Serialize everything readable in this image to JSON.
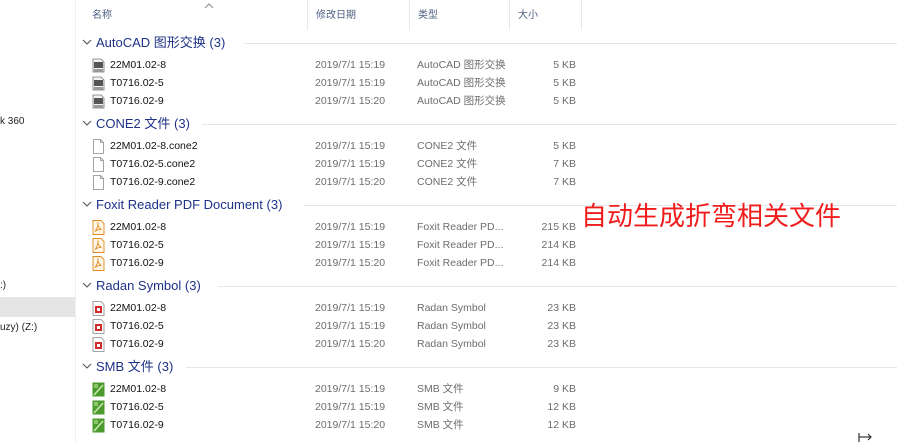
{
  "sidebar": {
    "items": [
      {
        "label": "k 360",
        "selected": false
      },
      {
        "label": ":)",
        "selected": false
      },
      {
        "label": "",
        "selected": true
      },
      {
        "label": "uzy) (Z:)",
        "selected": false
      }
    ]
  },
  "columns": {
    "name": "名称",
    "date": "修改日期",
    "type": "类型",
    "size": "大小"
  },
  "groups": [
    {
      "title": "AutoCAD 图形交换 (3)",
      "icon": "dxf-file-icon",
      "files": [
        {
          "name": "22M01.02-8",
          "date": "2019/7/1 15:19",
          "type": "AutoCAD 图形交换",
          "size": "5 KB"
        },
        {
          "name": "T0716.02-5",
          "date": "2019/7/1 15:19",
          "type": "AutoCAD 图形交换",
          "size": "5 KB"
        },
        {
          "name": "T0716.02-9",
          "date": "2019/7/1 15:20",
          "type": "AutoCAD 图形交换",
          "size": "5 KB"
        }
      ]
    },
    {
      "title": "CONE2 文件 (3)",
      "icon": "blank-file-icon",
      "files": [
        {
          "name": "22M01.02-8.cone2",
          "date": "2019/7/1 15:19",
          "type": "CONE2 文件",
          "size": "5 KB"
        },
        {
          "name": "T0716.02-5.cone2",
          "date": "2019/7/1 15:19",
          "type": "CONE2 文件",
          "size": "7 KB"
        },
        {
          "name": "T0716.02-9.cone2",
          "date": "2019/7/1 15:20",
          "type": "CONE2 文件",
          "size": "7 KB"
        }
      ]
    },
    {
      "title": "Foxit Reader PDF Document (3)",
      "icon": "pdf-file-icon",
      "files": [
        {
          "name": "22M01.02-8",
          "date": "2019/7/1 15:19",
          "type": "Foxit Reader PD...",
          "size": "215 KB"
        },
        {
          "name": "T0716.02-5",
          "date": "2019/7/1 15:19",
          "type": "Foxit Reader PD...",
          "size": "214 KB"
        },
        {
          "name": "T0716.02-9",
          "date": "2019/7/1 15:20",
          "type": "Foxit Reader PD...",
          "size": "214 KB"
        }
      ]
    },
    {
      "title": "Radan Symbol (3)",
      "icon": "radan-symbol-icon",
      "files": [
        {
          "name": "22M01.02-8",
          "date": "2019/7/1 15:19",
          "type": "Radan Symbol",
          "size": "23 KB"
        },
        {
          "name": "T0716.02-5",
          "date": "2019/7/1 15:19",
          "type": "Radan Symbol",
          "size": "23 KB"
        },
        {
          "name": "T0716.02-9",
          "date": "2019/7/1 15:20",
          "type": "Radan Symbol",
          "size": "23 KB"
        }
      ]
    },
    {
      "title": "SMB 文件 (3)",
      "icon": "smb-file-icon",
      "files": [
        {
          "name": "22M01.02-8",
          "date": "2019/7/1 15:19",
          "type": "SMB 文件",
          "size": "9 KB"
        },
        {
          "name": "T0716.02-5",
          "date": "2019/7/1 15:19",
          "type": "SMB 文件",
          "size": "12 KB"
        },
        {
          "name": "T0716.02-9",
          "date": "2019/7/1 15:20",
          "type": "SMB 文件",
          "size": "12 KB"
        }
      ]
    }
  ],
  "overlay": {
    "text": "自动生成折弯相关文件",
    "color": "#f01c1c"
  },
  "colors": {
    "group_title": "#1e3287",
    "header_text": "#4d6082",
    "sidebar_selected": "#e5e5e5"
  }
}
